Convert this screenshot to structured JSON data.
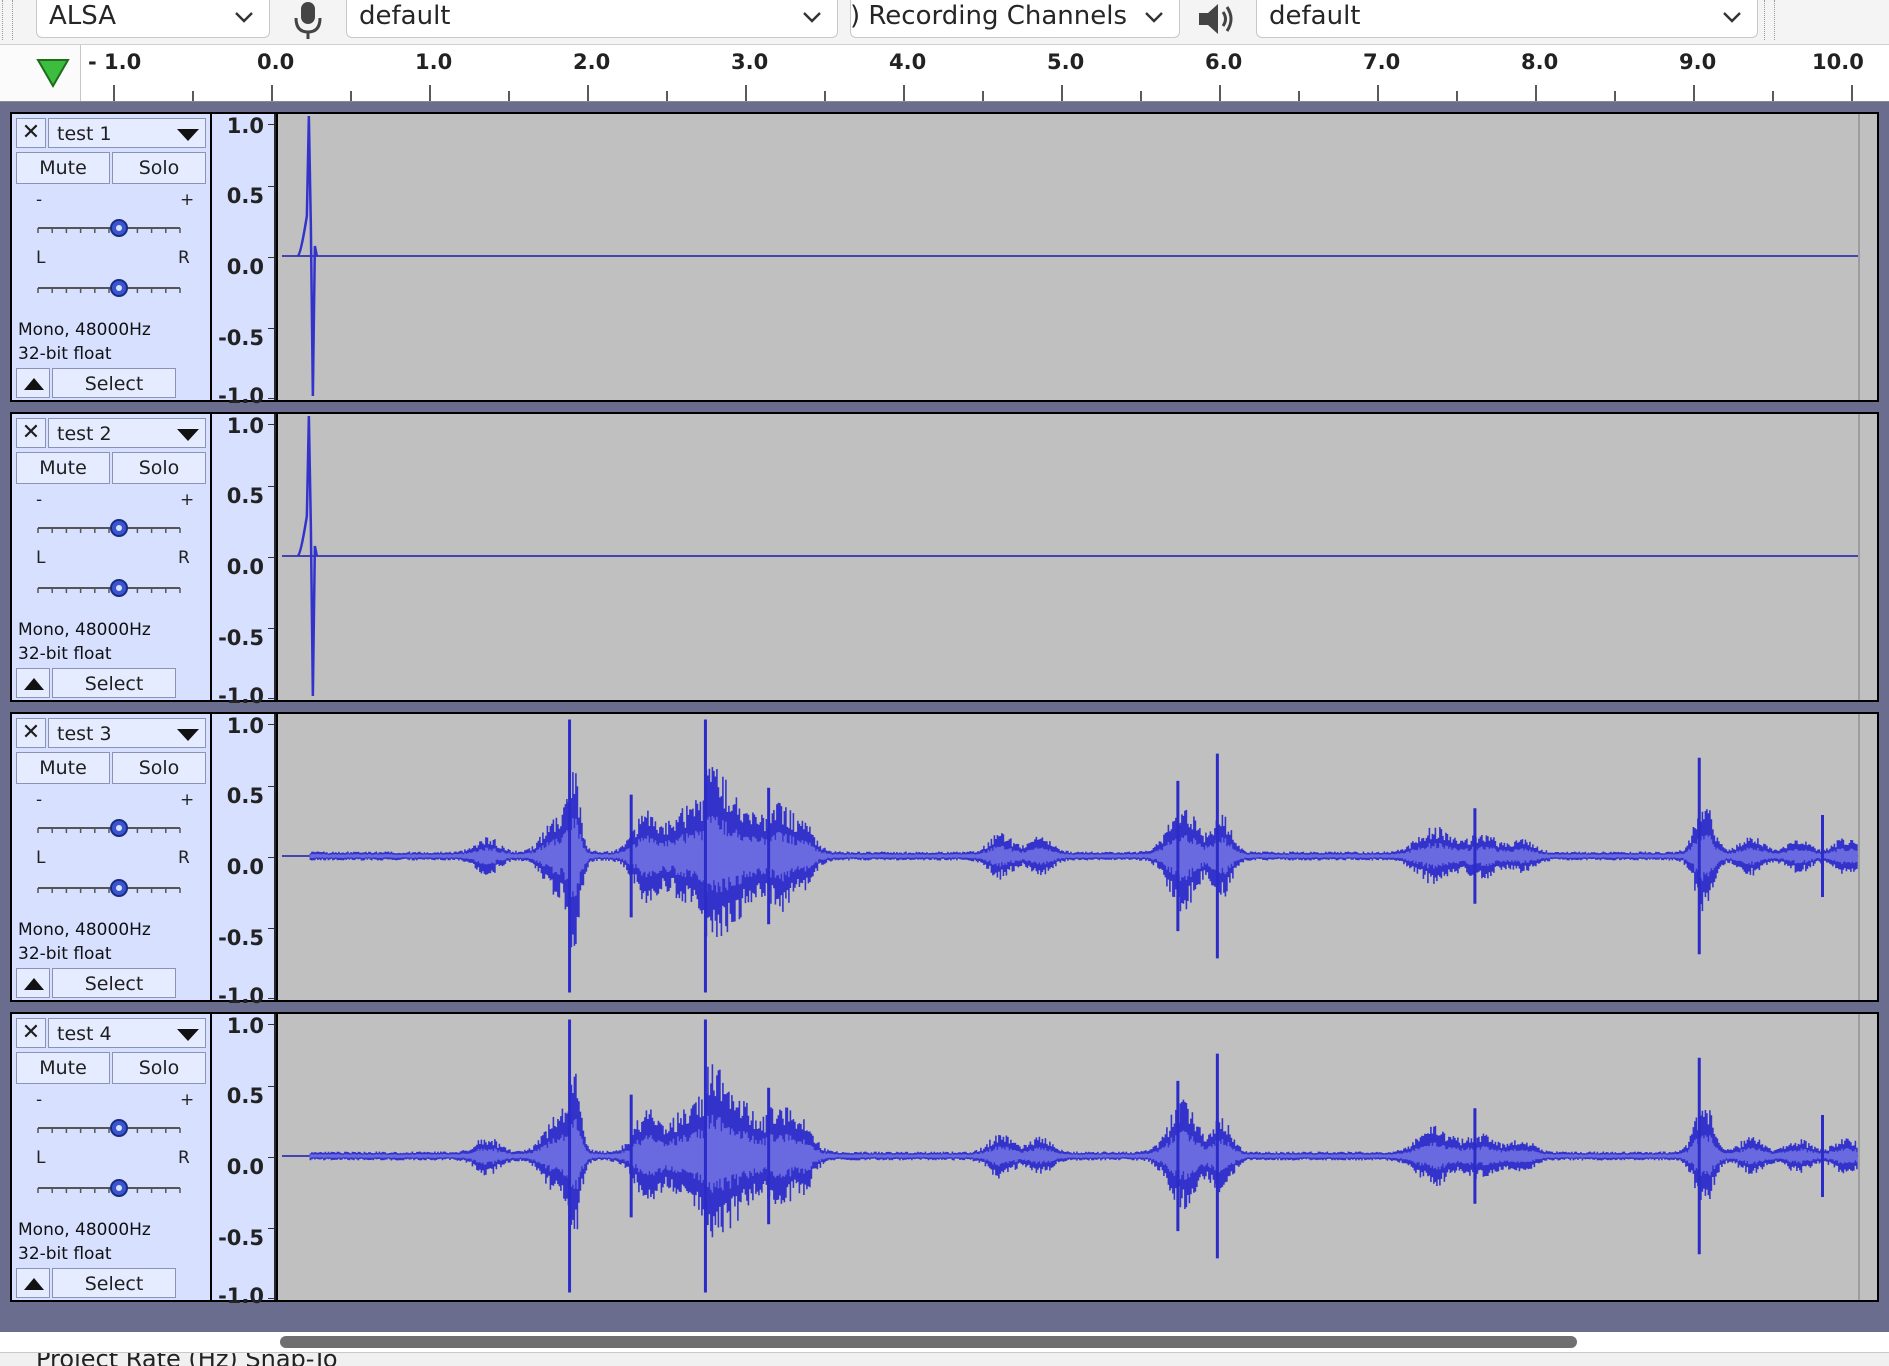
{
  "toolbar": {
    "host": "ALSA",
    "recording_device": "default",
    "recording_channels": "(Stereo) Recording Channels",
    "playback_device": "default"
  },
  "ruler": {
    "ticks": [
      "- 1.0",
      "0.0",
      "1.0",
      "2.0",
      "3.0",
      "4.0",
      "5.0",
      "6.0",
      "7.0",
      "8.0",
      "9.0",
      "10.0"
    ]
  },
  "tracks": [
    {
      "name": "test 1",
      "mute": "Mute",
      "solo": "Solo",
      "gain_minus": "-",
      "gain_plus": "+",
      "pan_left": "L",
      "pan_right": "R",
      "format": "Mono, 48000Hz",
      "bits": "32-bit float",
      "select": "Select",
      "scale": [
        "1.0",
        "0.5",
        "0.0",
        "-0.5",
        "-1.0"
      ]
    },
    {
      "name": "test 2",
      "mute": "Mute",
      "solo": "Solo",
      "gain_minus": "-",
      "gain_plus": "+",
      "pan_left": "L",
      "pan_right": "R",
      "format": "Mono, 48000Hz",
      "bits": "32-bit float",
      "select": "Select",
      "scale": [
        "1.0",
        "0.5",
        "0.0",
        "-0.5",
        "-1.0"
      ]
    },
    {
      "name": "test 3",
      "mute": "Mute",
      "solo": "Solo",
      "gain_minus": "-",
      "gain_plus": "+",
      "pan_left": "L",
      "pan_right": "R",
      "format": "Mono, 48000Hz",
      "bits": "32-bit float",
      "select": "Select",
      "scale": [
        "1.0",
        "0.5",
        "0.0",
        "-0.5",
        "-1.0"
      ]
    },
    {
      "name": "test 4",
      "mute": "Mute",
      "solo": "Solo",
      "gain_minus": "-",
      "gain_plus": "+",
      "pan_left": "L",
      "pan_right": "R",
      "format": "Mono, 48000Hz",
      "bits": "32-bit float",
      "select": "Select",
      "scale": [
        "1.0",
        "0.5",
        "0.0",
        "-0.5",
        "-1.0"
      ]
    }
  ],
  "status": {
    "project_rate_label": "Project Rate (Hz)   Snap-To"
  },
  "colors": {
    "waveform": "#3333cc",
    "waveform_rms": "#6666dd",
    "track_background": "#c0c0c0",
    "track_panel": "#d7e1ff",
    "play_head": "#2aa02a"
  },
  "icons": {
    "record_source": "microphone-icon",
    "playback_source": "speaker-icon",
    "play_indicator": "play-head-triangle-icon"
  }
}
